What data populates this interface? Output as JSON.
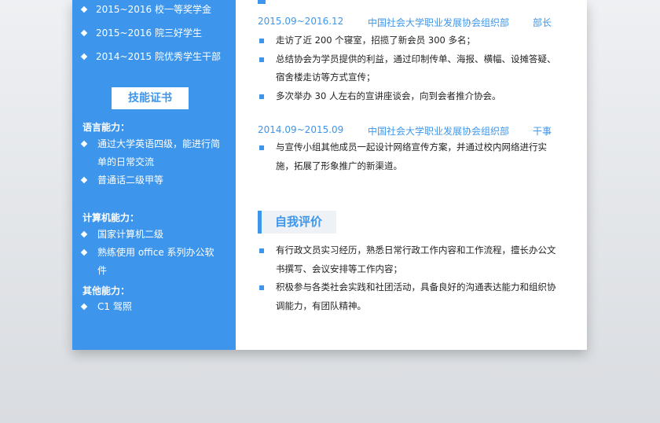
{
  "awards": [
    "2015~2016 校一等奖学金",
    "2015~2016 院三好学生",
    "2014~2015 院优秀学生干部"
  ],
  "skills": {
    "title": "技能证书",
    "language": {
      "label": "语言能力：",
      "items": [
        "通过大学英语四级，能进行简单的日常交流",
        "普通话二级甲等"
      ]
    },
    "computer": {
      "label": "计算机能力：",
      "items": [
        "国家计算机二级",
        "熟练使用 office 系列办公软件"
      ]
    },
    "other": {
      "label": "其他能力：",
      "items": [
        "C1 驾照"
      ]
    }
  },
  "experience": [
    {
      "period": "2015.09~2016.12",
      "org": "中国社会大学职业发展协会组织部",
      "role": "部长",
      "bullets": [
        "走访了近 200 个寝室，招揽了新会员 300 多名；",
        "总结协会为学员提供的利益，通过印制传单、海报、横幅、设摊答疑、宿舍楼走访等方式宣传；",
        "多次举办 30 人左右的宣讲座谈会，向到会者推介协会。"
      ]
    },
    {
      "period": "2014.09~2015.09",
      "org": "中国社会大学职业发展协会组织部",
      "role": "干事",
      "bullets": [
        "与宣传小组其他成员一起设计网络宣传方案，并通过校内网络进行实施，拓展了形象推广的新渠道。"
      ]
    }
  ],
  "self_eval": {
    "title": "自我评价",
    "bullets": [
      "有行政文员实习经历，熟悉日常行政工作内容和工作流程，擅长办公文书撰写、会议安排等工作内容；",
      "积极参与各类社会实践和社团活动，具备良好的沟通表达能力和组织协调能力，有团队精神。"
    ]
  },
  "colors": {
    "accent": "#3d96ec",
    "section_bg": "#eef1f6"
  }
}
